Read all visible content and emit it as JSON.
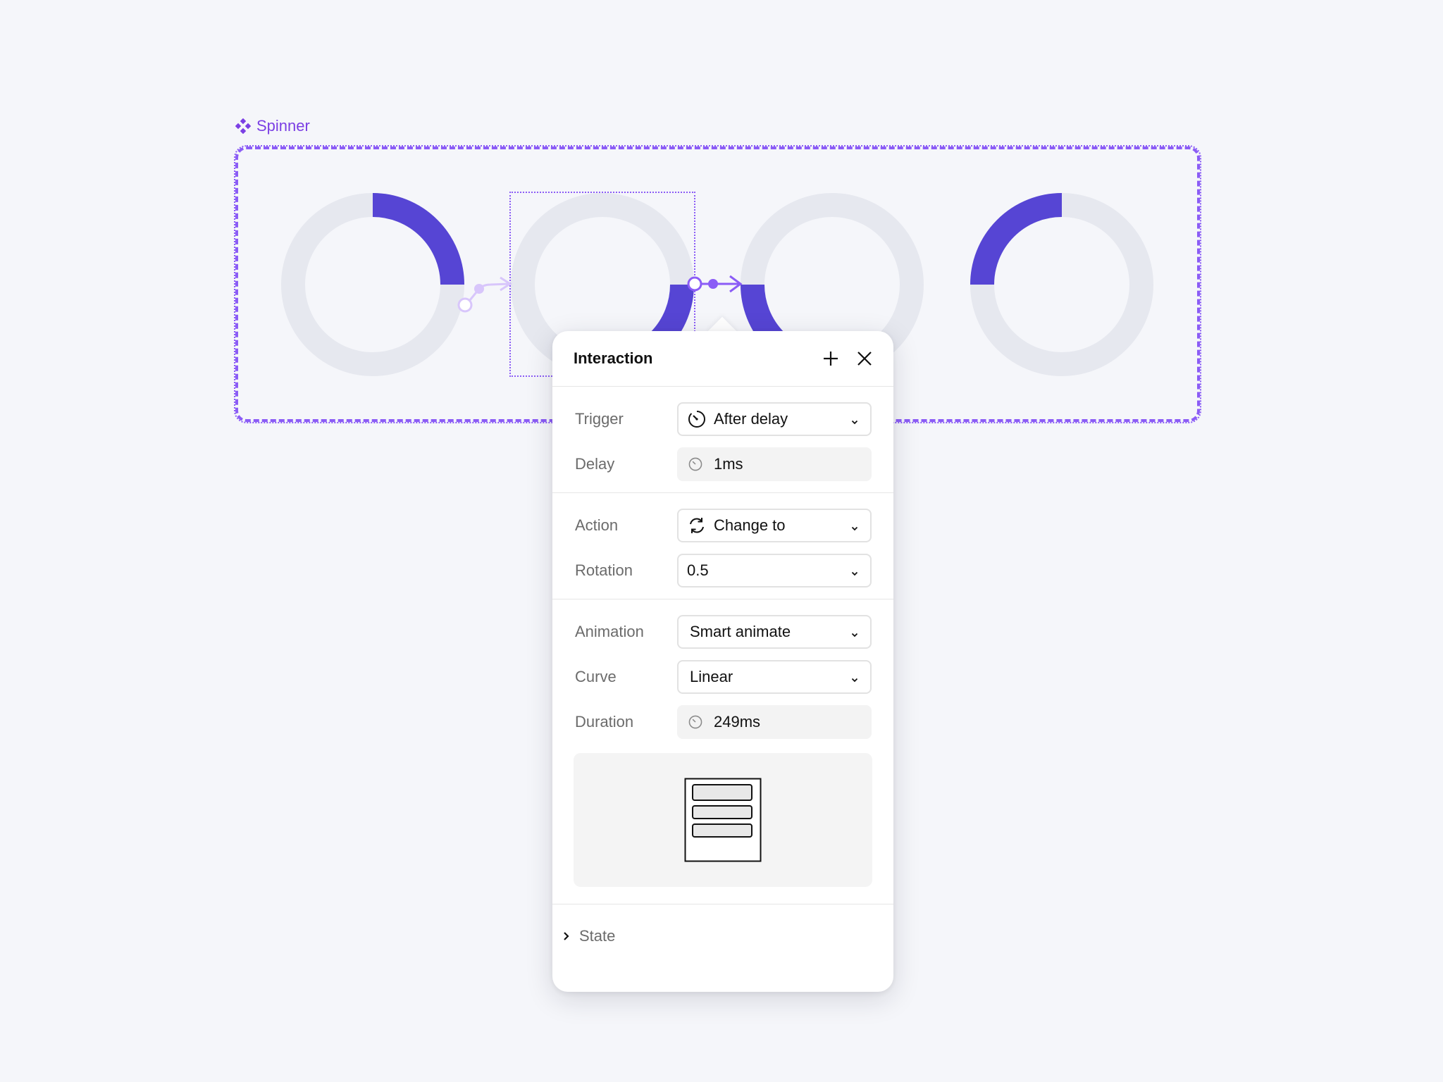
{
  "component": {
    "label": "Spinner",
    "icon": "component-icon",
    "accent_color": "#7b3fe4",
    "track_color": "#e6e8ef",
    "arc_color": "#5645d4"
  },
  "variants": [
    {
      "name": "spinner-variant-1"
    },
    {
      "name": "spinner-variant-2"
    },
    {
      "name": "spinner-variant-3"
    },
    {
      "name": "spinner-variant-4"
    }
  ],
  "panel": {
    "title": "Interaction",
    "add_icon": "plus-icon",
    "close_icon": "close-icon",
    "trigger": {
      "label": "Trigger",
      "value": "After delay",
      "icon": "timer-icon"
    },
    "delay": {
      "label": "Delay",
      "value": "1ms",
      "icon": "timer-icon"
    },
    "action": {
      "label": "Action",
      "value": "Change to",
      "icon": "refresh-icon"
    },
    "rotation": {
      "label": "Rotation",
      "value": "0.5"
    },
    "animation": {
      "label": "Animation",
      "value": "Smart animate"
    },
    "curve": {
      "label": "Curve",
      "value": "Linear"
    },
    "duration": {
      "label": "Duration",
      "value": "249ms",
      "icon": "timer-icon"
    },
    "preview_icon": "layout-preview-icon",
    "state": {
      "label": "State"
    }
  }
}
